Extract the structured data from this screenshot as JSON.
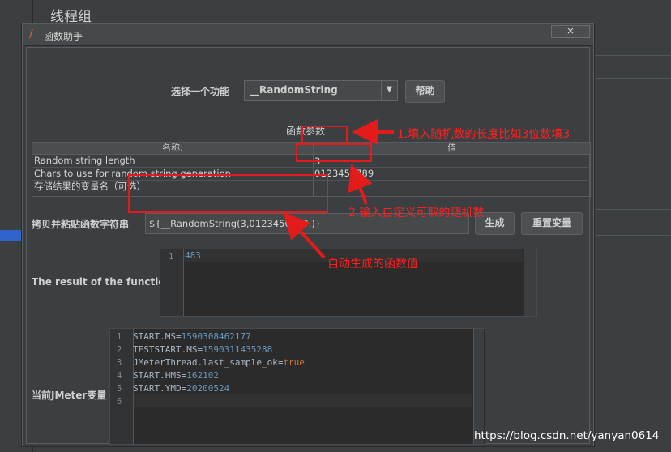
{
  "background": {
    "title": "线程组"
  },
  "dialog": {
    "title": "函数助手",
    "close_label": "×",
    "select_label": "选择一个功能",
    "function_selected": "__RandomString",
    "help_button": "帮助",
    "params_header": "函数参数",
    "table": {
      "columns": [
        "名称:",
        "值"
      ],
      "rows": [
        {
          "name": "Random string length",
          "value": "3"
        },
        {
          "name": "Chars to use for random string generation",
          "value": "0123456789"
        },
        {
          "name": "存储结果的变量名（可选）",
          "value": ""
        }
      ]
    },
    "copy_label": "拷贝并粘贴函数字符串",
    "function_string": "${__RandomString(3,0123456789,)}",
    "generate_button": "生成",
    "reset_button": "重置变量",
    "result_label": "The result of the function is",
    "result_lines": [
      {
        "num": "1",
        "text": "483"
      }
    ],
    "vars_label": "当前JMeter变量",
    "vars_lines": [
      {
        "num": "1",
        "key": "START.MS",
        "value": "1590308462177"
      },
      {
        "num": "2",
        "key": "TESTSTART.MS",
        "value": "1590311435288"
      },
      {
        "num": "3",
        "key": "JMeterThread.last_sample_ok",
        "value": "true"
      },
      {
        "num": "4",
        "key": "START.HMS",
        "value": "162102"
      },
      {
        "num": "5",
        "key": "START.YMD",
        "value": "20200524"
      },
      {
        "num": "6",
        "key": "",
        "value": ""
      }
    ]
  },
  "annotations": {
    "a1": "1.填入随机数的长度比如3位数填3",
    "a2": "2.输入自定义可取的随机数",
    "a3": "自动生成的函数值"
  },
  "watermark": "https://blog.csdn.net/yanyan0614",
  "colors": {
    "annotation": "#e31b1b",
    "number": "#6897bb",
    "keyword": "#cc7832"
  }
}
